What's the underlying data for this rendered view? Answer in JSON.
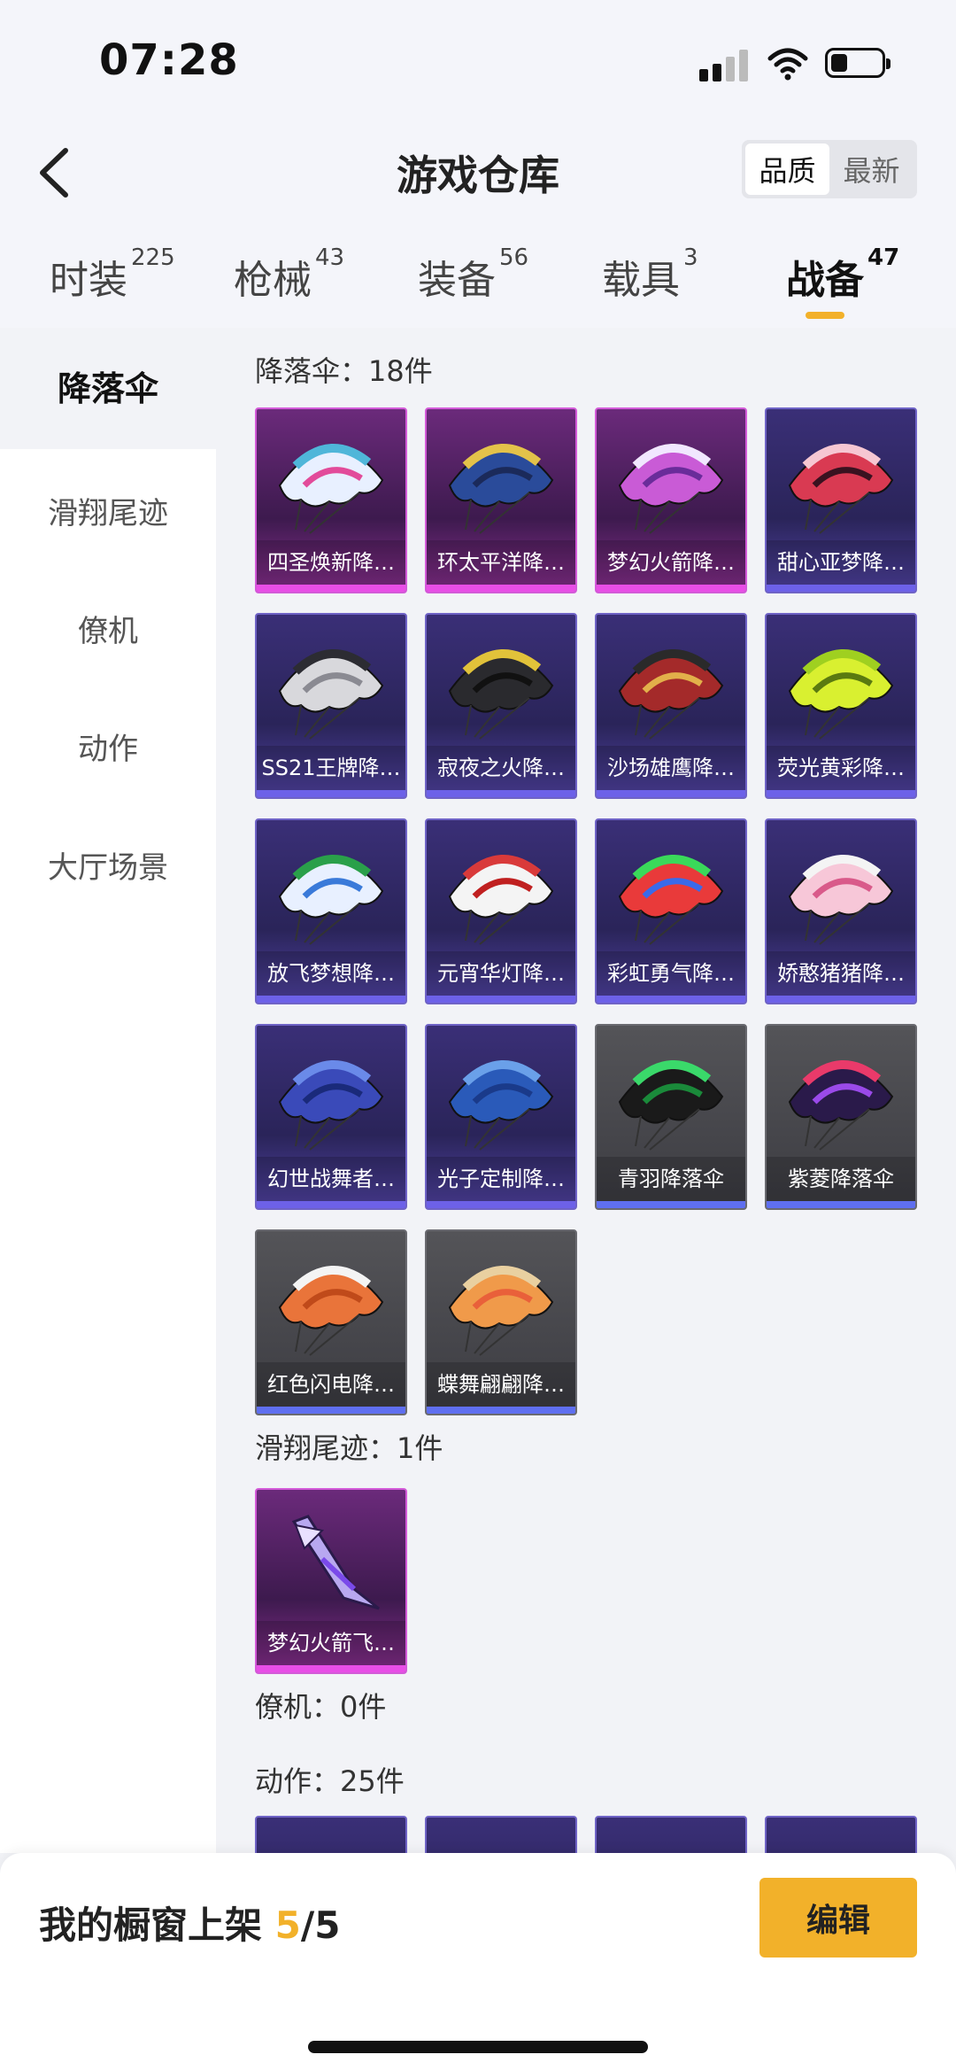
{
  "status": {
    "time": "07:28"
  },
  "nav": {
    "title": "游戏仓库",
    "sort_quality": "品质",
    "sort_latest": "最新"
  },
  "tabs": [
    {
      "label": "时装",
      "count": "225"
    },
    {
      "label": "枪械",
      "count": "43"
    },
    {
      "label": "装备",
      "count": "56"
    },
    {
      "label": "载具",
      "count": "3"
    },
    {
      "label": "战备",
      "count": "47"
    }
  ],
  "sidebar": [
    "降落伞",
    "滑翔尾迹",
    "僚机",
    "动作",
    "大厅场景"
  ],
  "sections": {
    "parachute": {
      "title": "降落伞：18件"
    },
    "trail": {
      "title": "滑翔尾迹：1件"
    },
    "wingman": {
      "title": "僚机：0件"
    },
    "emote": {
      "title": "动作：25件"
    }
  },
  "parachutes": [
    {
      "name": "四圣焕新降…",
      "rarity": "pink"
    },
    {
      "name": "环太平洋降…",
      "rarity": "pink"
    },
    {
      "name": "梦幻火箭降…",
      "rarity": "pink"
    },
    {
      "name": "甜心亚梦降…",
      "rarity": "purple"
    },
    {
      "name": "SS21王牌降…",
      "rarity": "purple"
    },
    {
      "name": "寂夜之火降…",
      "rarity": "purple"
    },
    {
      "name": "沙场雄鹰降…",
      "rarity": "purple"
    },
    {
      "name": "荧光黄彩降…",
      "rarity": "purple"
    },
    {
      "name": "放飞梦想降…",
      "rarity": "purple"
    },
    {
      "name": "元宵华灯降…",
      "rarity": "purple"
    },
    {
      "name": "彩虹勇气降…",
      "rarity": "purple"
    },
    {
      "name": "娇憨猪猪降…",
      "rarity": "purple"
    },
    {
      "name": "幻世战舞者…",
      "rarity": "purple"
    },
    {
      "name": "光子定制降…",
      "rarity": "purple"
    },
    {
      "name": "青羽降落伞",
      "rarity": "gray"
    },
    {
      "name": "紫菱降落伞",
      "rarity": "gray"
    },
    {
      "name": "红色闪电降…",
      "rarity": "gray"
    },
    {
      "name": "蝶舞翩翩降…",
      "rarity": "gray"
    }
  ],
  "trails": [
    {
      "name": "梦幻火箭飞…",
      "rarity": "pink"
    }
  ],
  "bottom": {
    "shelf_prefix": "我的橱窗上架 ",
    "shelf_count": "5",
    "shelf_total": "/5",
    "edit_label": "编辑"
  },
  "colors": {
    "accent": "#f2b12a",
    "pink_border": "#d35ad8",
    "purple_border": "#6f63c6"
  }
}
